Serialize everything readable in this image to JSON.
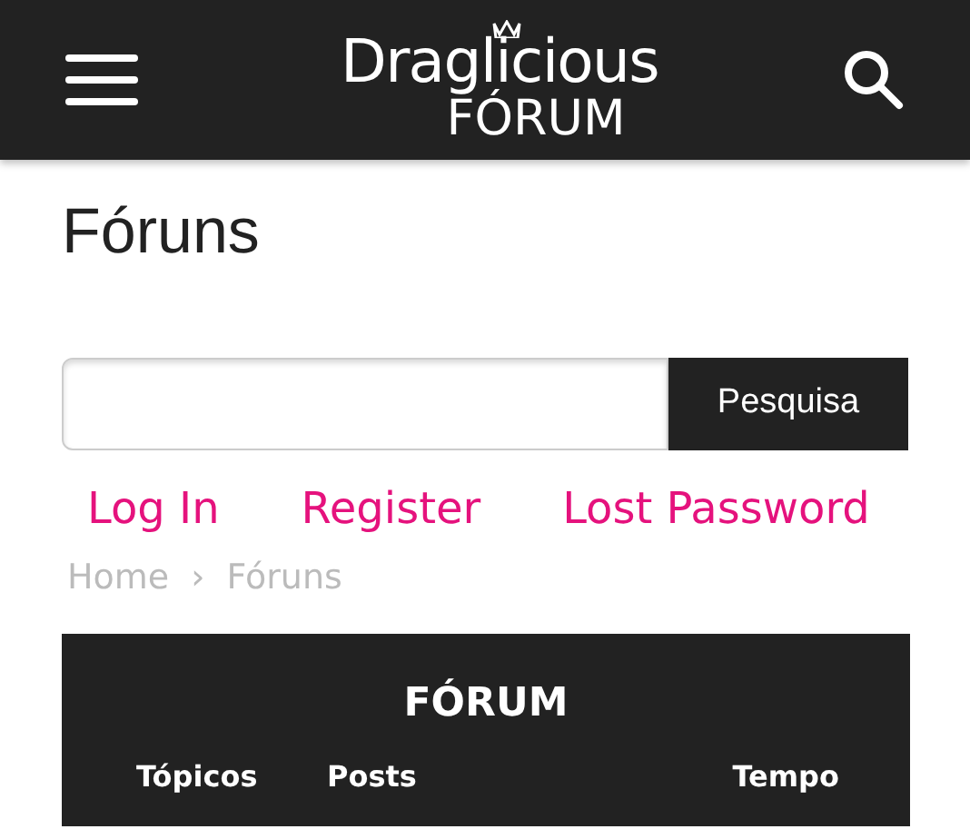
{
  "header": {
    "logo": {
      "line_1": "Draglicious",
      "line_2": "FÓRUM"
    }
  },
  "page_title": "Fóruns",
  "search": {
    "button": "Pesquisa"
  },
  "auth_links": [
    "Log In",
    "Register",
    "Lost Password"
  ],
  "breadcrumb": {
    "items": [
      "Home",
      "Fóruns"
    ],
    "separator": "›"
  },
  "forum_table": {
    "title": "FÓRUM",
    "columns": [
      "Tópicos",
      "Posts",
      "Tempo"
    ]
  }
}
